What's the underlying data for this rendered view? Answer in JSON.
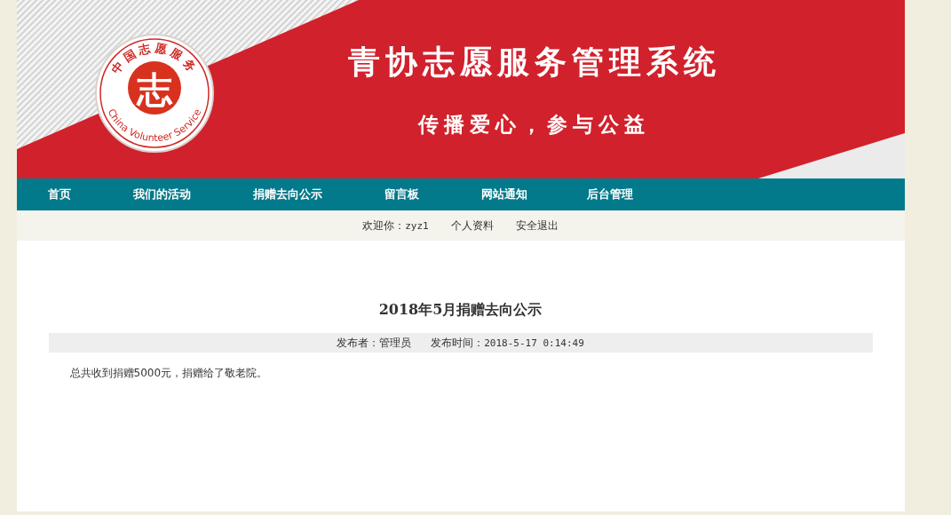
{
  "banner": {
    "logo": {
      "top_text": "中国志愿服务",
      "center_text": "志",
      "bottom_text": "China Volunteer Service"
    },
    "title": "青协志愿服务管理系统",
    "slogan": "传播爱心，参与公益"
  },
  "nav": {
    "items": [
      {
        "label": "首页"
      },
      {
        "label": "我们的活动"
      },
      {
        "label": "捐赠去向公示"
      },
      {
        "label": "留言板"
      },
      {
        "label": "网站通知"
      },
      {
        "label": "后台管理"
      }
    ]
  },
  "user_bar": {
    "welcome": "欢迎你：",
    "username": "zyz1",
    "links": [
      "个人资料",
      "安全退出"
    ]
  },
  "article": {
    "title": "2018年5月捐赠去向公示",
    "publisher_label": "发布者：",
    "publisher": "管理员",
    "time_label": "发布时间：",
    "time": "2018-5-17 0:14:49",
    "body": "总共收到捐赠5000元，捐赠给了敬老院。"
  }
}
